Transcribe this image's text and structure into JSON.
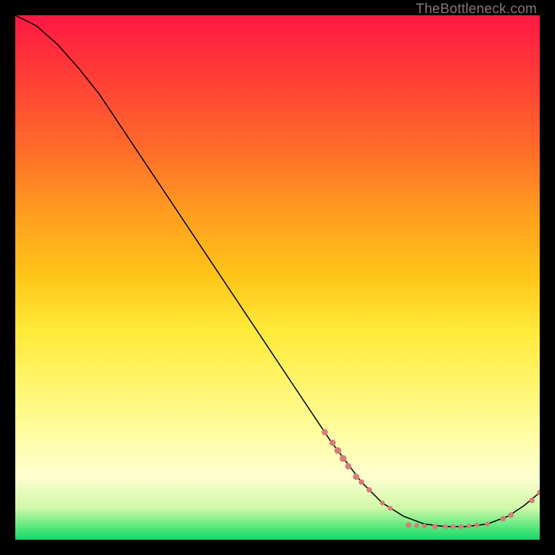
{
  "watermark": "TheBottleneck.com",
  "colors": {
    "page_bg": "#000000",
    "watermark": "#7a7a7a",
    "curve": "#000000",
    "points": "#d67d78"
  },
  "chart_data": {
    "type": "line",
    "title": "",
    "xlabel": "",
    "ylabel": "",
    "x_range": [
      0,
      100
    ],
    "y_range": [
      0,
      100
    ],
    "curve": {
      "x": [
        0,
        4,
        8,
        12,
        16,
        20,
        28,
        36,
        44,
        52,
        60,
        66,
        70,
        74,
        78,
        82,
        86,
        90,
        94,
        97,
        100
      ],
      "y": [
        100,
        98,
        94.5,
        90,
        85,
        79,
        67,
        55,
        43,
        31,
        19,
        11,
        7,
        4.5,
        3,
        2.5,
        2.5,
        3,
        4.5,
        6.5,
        9
      ]
    },
    "points": [
      {
        "x": 59,
        "y": 20.5,
        "r": 4.5
      },
      {
        "x": 60.5,
        "y": 18.5,
        "r": 4.5
      },
      {
        "x": 61.5,
        "y": 17,
        "r": 5.0
      },
      {
        "x": 62.5,
        "y": 15.5,
        "r": 5.0
      },
      {
        "x": 63.5,
        "y": 14,
        "r": 4.5
      },
      {
        "x": 65,
        "y": 12,
        "r": 4.5
      },
      {
        "x": 66,
        "y": 11,
        "r": 4.0
      },
      {
        "x": 67.5,
        "y": 9.5,
        "r": 4.0
      },
      {
        "x": 70,
        "y": 7,
        "r": 3.5
      },
      {
        "x": 71.5,
        "y": 6,
        "r": 3.5
      },
      {
        "x": 75,
        "y": 2.8,
        "r": 4.0
      },
      {
        "x": 76.5,
        "y": 2.7,
        "r": 3.5
      },
      {
        "x": 78,
        "y": 2.6,
        "r": 3.5
      },
      {
        "x": 80,
        "y": 2.5,
        "r": 4.0
      },
      {
        "x": 82,
        "y": 2.5,
        "r": 3.5
      },
      {
        "x": 83.5,
        "y": 2.5,
        "r": 3.5
      },
      {
        "x": 85,
        "y": 2.5,
        "r": 3.5
      },
      {
        "x": 86.5,
        "y": 2.6,
        "r": 3.5
      },
      {
        "x": 88,
        "y": 2.8,
        "r": 3.5
      },
      {
        "x": 90,
        "y": 3,
        "r": 3.5
      },
      {
        "x": 93,
        "y": 4,
        "r": 4.0
      },
      {
        "x": 94.5,
        "y": 4.7,
        "r": 4.0
      },
      {
        "x": 98.5,
        "y": 7.5,
        "r": 4.0
      },
      {
        "x": 100,
        "y": 9,
        "r": 4.0
      }
    ]
  }
}
